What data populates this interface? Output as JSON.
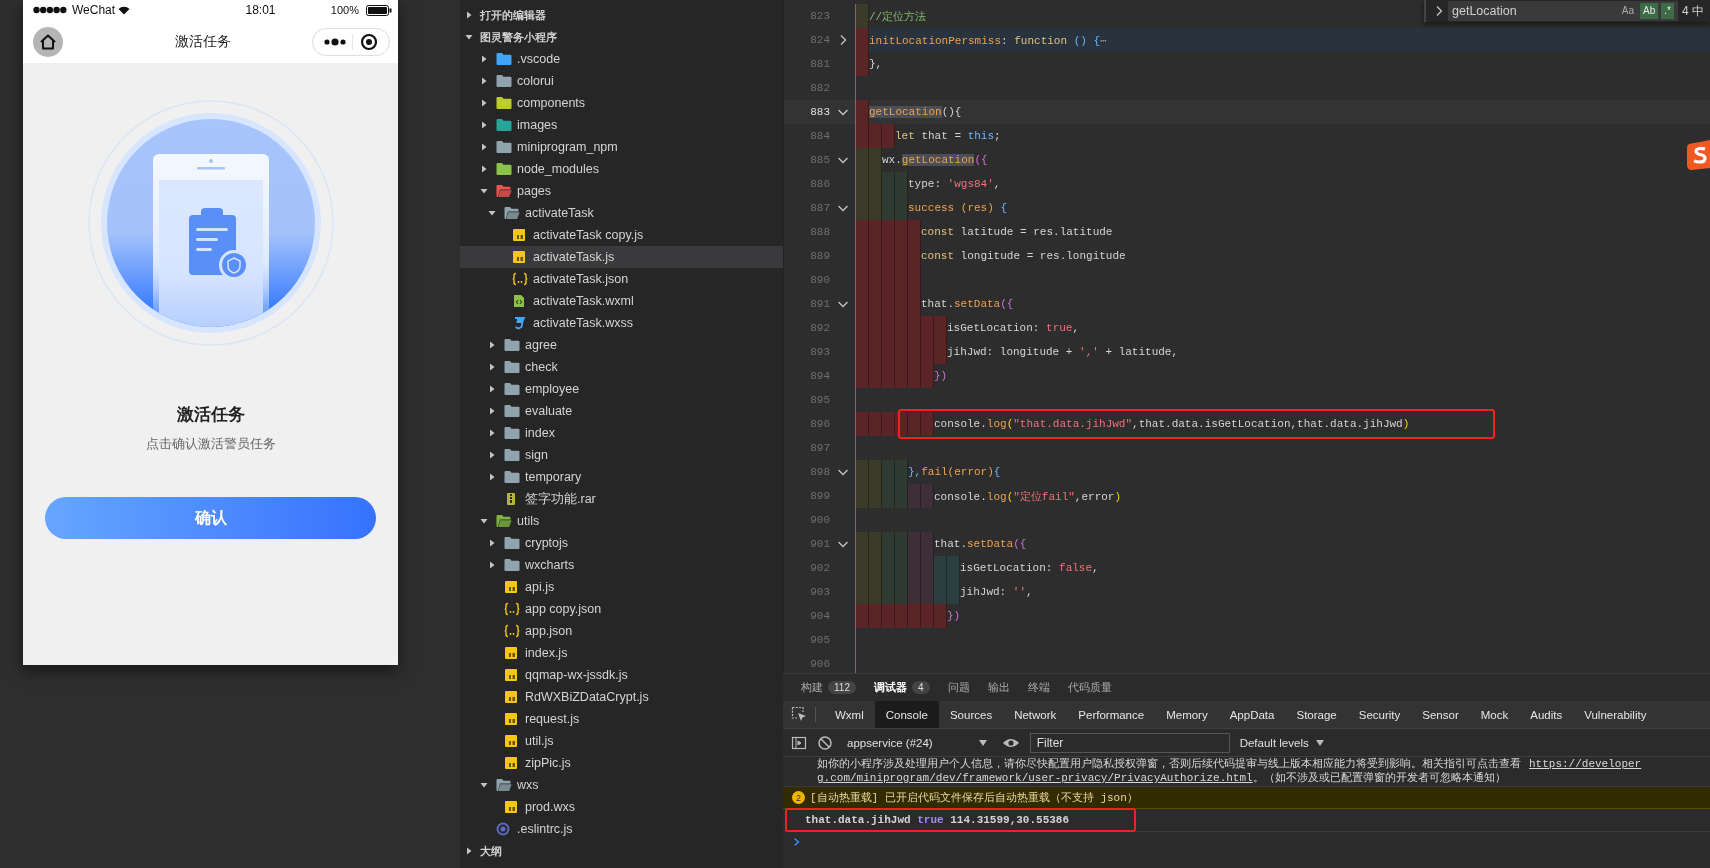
{
  "simulator": {
    "status": {
      "carrier": "WeChat",
      "time": "18:01",
      "battery": "100%"
    },
    "title": "激活任务",
    "heading": "激活任务",
    "subtitle": "点击确认激活警员任务",
    "button": "确认"
  },
  "explorer": {
    "sections": [
      {
        "label": "打开的编辑器",
        "expanded": false
      },
      {
        "label": "图灵警务小程序",
        "expanded": true,
        "items": [
          {
            "name": ".vscode",
            "kind": "folder-vscode",
            "expanded": false,
            "selected": false
          },
          {
            "name": "colorui",
            "kind": "folder",
            "expanded": false,
            "selected": false
          },
          {
            "name": "components",
            "kind": "folder-components",
            "expanded": false,
            "selected": false
          },
          {
            "name": "images",
            "kind": "folder-images",
            "expanded": false,
            "selected": false
          },
          {
            "name": "miniprogram_npm",
            "kind": "folder",
            "expanded": false,
            "selected": false
          },
          {
            "name": "node_modules",
            "kind": "folder-node",
            "expanded": false,
            "selected": false
          },
          {
            "name": "pages",
            "kind": "folder-pages",
            "expanded": true,
            "selected": false,
            "children": [
              {
                "name": "activateTask",
                "kind": "folder",
                "expanded": true,
                "selected": false,
                "children": [
                  {
                    "name": "activateTask copy.js",
                    "kind": "js",
                    "selected": false
                  },
                  {
                    "name": "activateTask.js",
                    "kind": "js",
                    "selected": true
                  },
                  {
                    "name": "activateTask.json",
                    "kind": "json",
                    "selected": false
                  },
                  {
                    "name": "activateTask.wxml",
                    "kind": "wxml",
                    "selected": false
                  },
                  {
                    "name": "activateTask.wxss",
                    "kind": "wxss",
                    "selected": false
                  }
                ]
              },
              {
                "name": "agree",
                "kind": "folder",
                "expanded": false,
                "selected": false
              },
              {
                "name": "check",
                "kind": "folder",
                "expanded": false,
                "selected": false
              },
              {
                "name": "employee",
                "kind": "folder",
                "expanded": false,
                "selected": false
              },
              {
                "name": "evaluate",
                "kind": "folder",
                "expanded": false,
                "selected": false
              },
              {
                "name": "index",
                "kind": "folder",
                "expanded": false,
                "selected": false
              },
              {
                "name": "sign",
                "kind": "folder",
                "expanded": false,
                "selected": false
              },
              {
                "name": "temporary",
                "kind": "folder",
                "expanded": false,
                "selected": false
              },
              {
                "name": "签字功能.rar",
                "kind": "rar",
                "selected": false
              }
            ]
          },
          {
            "name": "utils",
            "kind": "folder-utils",
            "expanded": true,
            "selected": false,
            "children": [
              {
                "name": "cryptojs",
                "kind": "folder",
                "expanded": false,
                "selected": false
              },
              {
                "name": "wxcharts",
                "kind": "folder",
                "expanded": false,
                "selected": false
              },
              {
                "name": "api.js",
                "kind": "js",
                "selected": false
              },
              {
                "name": "app copy.json",
                "kind": "json",
                "selected": false
              },
              {
                "name": "app.json",
                "kind": "json",
                "selected": false
              },
              {
                "name": "index.js",
                "kind": "js",
                "selected": false
              },
              {
                "name": "qqmap-wx-jssdk.js",
                "kind": "js",
                "selected": false
              },
              {
                "name": "RdWXBiZDataCrypt.js",
                "kind": "js",
                "selected": false
              },
              {
                "name": "request.js",
                "kind": "js",
                "selected": false
              },
              {
                "name": "util.js",
                "kind": "js",
                "selected": false
              },
              {
                "name": "zipPic.js",
                "kind": "js",
                "selected": false
              }
            ]
          },
          {
            "name": "wxs",
            "kind": "folder",
            "expanded": true,
            "selected": false,
            "children": [
              {
                "name": "prod.wxs",
                "kind": "js",
                "selected": false
              }
            ]
          },
          {
            "name": ".eslintrc.js",
            "kind": "eslint",
            "selected": false
          }
        ]
      },
      {
        "label": "大纲",
        "expanded": false
      }
    ]
  },
  "find": {
    "query": "getLocation",
    "toggles": [
      {
        "label": "Aa",
        "selected": false
      },
      {
        "label": "Ab",
        "selected": true
      },
      {
        "label": ".*",
        "selected": true
      }
    ],
    "result": "4 中"
  },
  "editor": {
    "lines": [
      {
        "n": "823",
        "current": false,
        "guides": [
          {
            "color": "#3b3b2a"
          }
        ],
        "tokens": [
          {
            "text": "//定位方法",
            "kind": "comment"
          }
        ]
      },
      {
        "n": "824",
        "current": false,
        "folded": true,
        "guides": [
          {
            "color": "#5b2527"
          }
        ],
        "tokens": [
          {
            "text": "initLocationPersmiss",
            "kind": "fn"
          },
          {
            "text": ": ",
            "kind": "plain"
          },
          {
            "text": "function",
            "kind": "kw"
          },
          {
            "text": " () {",
            "kind": "const"
          },
          {
            "text": "⋯",
            "kind": "dim"
          }
        ]
      },
      {
        "n": "881",
        "current": false,
        "guides": [
          {
            "color": "#5b2527"
          }
        ],
        "tokens": [
          {
            "text": "},",
            "kind": "plain"
          }
        ]
      },
      {
        "n": "882",
        "current": false
      },
      {
        "n": "883",
        "current": true,
        "folded": false,
        "guides": [
          {
            "color": "#5b2527"
          }
        ],
        "tokens": [
          {
            "text": "getLocation",
            "kind": "fn",
            "match": true
          },
          {
            "text": "(){",
            "kind": "plain"
          }
        ]
      },
      {
        "n": "884",
        "current": false,
        "guides": [
          {
            "color": "#5b2527"
          },
          {
            "color": "#5b2527"
          },
          {
            "color": "#5b2527"
          }
        ],
        "tokens": [
          {
            "text": "let",
            "kind": "kw"
          },
          {
            "text": " that = ",
            "kind": "plain"
          },
          {
            "text": "this",
            "kind": "const"
          },
          {
            "text": ";",
            "kind": "plain"
          }
        ]
      },
      {
        "n": "885",
        "current": false,
        "folded": false,
        "guides": [
          {
            "color": "#3b3b2a"
          },
          {
            "color": "#3b3b2a"
          }
        ],
        "tokens": [
          {
            "text": "wx.",
            "kind": "plain"
          },
          {
            "text": "getLocation",
            "kind": "fn",
            "match": true
          },
          {
            "text": "({",
            "kind": "br2"
          }
        ]
      },
      {
        "n": "886",
        "current": false,
        "guides": [
          {
            "color": "#3b3b2a"
          },
          {
            "color": "#3b3b2a"
          },
          {
            "color": "#2f3a32"
          },
          {
            "color": "#2f3a32"
          }
        ],
        "tokens": [
          {
            "text": "type: ",
            "kind": "plain"
          },
          {
            "text": "'wgs84'",
            "kind": "str"
          },
          {
            "text": ",",
            "kind": "plain"
          }
        ]
      },
      {
        "n": "887",
        "current": false,
        "folded": false,
        "guides": [
          {
            "color": "#3b3b2a"
          },
          {
            "color": "#3b3b2a"
          },
          {
            "color": "#2f3a32"
          },
          {
            "color": "#2f3a32"
          }
        ],
        "tokens": [
          {
            "text": "success",
            "kind": "fn"
          },
          {
            "text": " (res) ",
            "kind": "fn"
          },
          {
            "text": "{",
            "kind": "const"
          }
        ]
      },
      {
        "n": "888",
        "current": false,
        "guides": [
          {
            "color": "#5b2527"
          },
          {
            "color": "#5b2527"
          },
          {
            "color": "#5b2527"
          },
          {
            "color": "#5b2527"
          },
          {
            "color": "#5b2527"
          }
        ],
        "tokens": [
          {
            "text": "const",
            "kind": "kw"
          },
          {
            "text": " latitude = res.latitude",
            "kind": "plain"
          }
        ]
      },
      {
        "n": "889",
        "current": false,
        "guides": [
          {
            "color": "#5b2527"
          },
          {
            "color": "#5b2527"
          },
          {
            "color": "#5b2527"
          },
          {
            "color": "#5b2527"
          },
          {
            "color": "#5b2527"
          }
        ],
        "tokens": [
          {
            "text": "const",
            "kind": "kw"
          },
          {
            "text": " longitude = res.longitude",
            "kind": "plain"
          }
        ]
      },
      {
        "n": "890",
        "current": false,
        "guides": [
          {
            "color": "#5b2527"
          },
          {
            "color": "#5b2527"
          },
          {
            "color": "#5b2527"
          },
          {
            "color": "#5b2527"
          },
          {
            "color": "#5b2527"
          }
        ]
      },
      {
        "n": "891",
        "current": false,
        "folded": false,
        "guides": [
          {
            "color": "#5b2527"
          },
          {
            "color": "#5b2527"
          },
          {
            "color": "#5b2527"
          },
          {
            "color": "#5b2527"
          },
          {
            "color": "#5b2527"
          }
        ],
        "tokens": [
          {
            "text": "that.",
            "kind": "plain"
          },
          {
            "text": "setData",
            "kind": "fn"
          },
          {
            "text": "({",
            "kind": "br2"
          }
        ]
      },
      {
        "n": "892",
        "current": false,
        "guides": [
          {
            "color": "#5b2527"
          },
          {
            "color": "#5b2527"
          },
          {
            "color": "#5b2527"
          },
          {
            "color": "#5b2527"
          },
          {
            "color": "#5b2527"
          },
          {
            "color": "#5b2527"
          },
          {
            "color": "#5b2527"
          }
        ],
        "tokens": [
          {
            "text": "isGetLocation: ",
            "kind": "plain"
          },
          {
            "text": "true",
            "kind": "str"
          },
          {
            "text": ",",
            "kind": "plain"
          }
        ]
      },
      {
        "n": "893",
        "current": false,
        "guides": [
          {
            "color": "#5b2527"
          },
          {
            "color": "#5b2527"
          },
          {
            "color": "#5b2527"
          },
          {
            "color": "#5b2527"
          },
          {
            "color": "#5b2527"
          },
          {
            "color": "#5b2527"
          },
          {
            "color": "#5b2527"
          }
        ],
        "tokens": [
          {
            "text": "jihJwd: longitude + ",
            "kind": "plain"
          },
          {
            "text": "','",
            "kind": "str"
          },
          {
            "text": " + latitude,",
            "kind": "plain"
          }
        ]
      },
      {
        "n": "894",
        "current": false,
        "guides": [
          {
            "color": "#5b2527"
          },
          {
            "color": "#5b2527"
          },
          {
            "color": "#5b2527"
          },
          {
            "color": "#5b2527"
          },
          {
            "color": "#5b2527"
          },
          {
            "color": "#5b2527"
          }
        ],
        "tokens": [
          {
            "text": "})",
            "kind": "br2"
          }
        ]
      },
      {
        "n": "895",
        "current": false
      },
      {
        "n": "896",
        "current": false,
        "boxed": true,
        "guides": [
          {
            "color": "#5b2527"
          },
          {
            "color": "#5b2527"
          },
          {
            "color": "#5b2527"
          },
          {
            "color": "#5b2527"
          },
          {
            "color": "#5b2527"
          },
          {
            "color": "#5b2527"
          }
        ],
        "tokens": [
          {
            "text": "console.",
            "kind": "plain"
          },
          {
            "text": "log",
            "kind": "fn"
          },
          {
            "text": "(",
            "kind": "br1"
          },
          {
            "text": "\"that.data.jihJwd\"",
            "kind": "str"
          },
          {
            "text": ",that.data.isGetLocation,that.data.jihJwd",
            "kind": "plain"
          },
          {
            "text": ")",
            "kind": "br1"
          }
        ]
      },
      {
        "n": "897",
        "current": false
      },
      {
        "n": "898",
        "current": false,
        "folded": false,
        "guides": [
          {
            "color": "#3b3b2a"
          },
          {
            "color": "#3b3b2a"
          },
          {
            "color": "#2f3a32"
          },
          {
            "color": "#2f3a32"
          }
        ],
        "tokens": [
          {
            "text": "},",
            "kind": "const"
          },
          {
            "text": "fail",
            "kind": "fn"
          },
          {
            "text": "(error)",
            "kind": "fn"
          },
          {
            "text": "{",
            "kind": "const"
          }
        ]
      },
      {
        "n": "899",
        "current": false,
        "guides": [
          {
            "color": "#3b3b2a"
          },
          {
            "color": "#3b3b2a"
          },
          {
            "color": "#2f3a32"
          },
          {
            "color": "#2f3a32"
          },
          {
            "color": "#3d2e37"
          },
          {
            "color": "#3d2e37"
          }
        ],
        "tokens": [
          {
            "text": "console.",
            "kind": "plain"
          },
          {
            "text": "log",
            "kind": "fn"
          },
          {
            "text": "(",
            "kind": "br1"
          },
          {
            "text": "\"定位fail\"",
            "kind": "str"
          },
          {
            "text": ",error",
            "kind": "plain"
          },
          {
            "text": ")",
            "kind": "br1"
          }
        ]
      },
      {
        "n": "900",
        "current": false
      },
      {
        "n": "901",
        "current": false,
        "folded": false,
        "guides": [
          {
            "color": "#3b3b2a"
          },
          {
            "color": "#3b3b2a"
          },
          {
            "color": "#2f3a32"
          },
          {
            "color": "#2f3a32"
          },
          {
            "color": "#3d2e37"
          },
          {
            "color": "#3d2e37"
          }
        ],
        "tokens": [
          {
            "text": "that.",
            "kind": "plain"
          },
          {
            "text": "setData",
            "kind": "fn"
          },
          {
            "text": "({",
            "kind": "br2"
          }
        ]
      },
      {
        "n": "902",
        "current": false,
        "guides": [
          {
            "color": "#3b3b2a"
          },
          {
            "color": "#3b3b2a"
          },
          {
            "color": "#2f3a32"
          },
          {
            "color": "#2f3a32"
          },
          {
            "color": "#3d2e37"
          },
          {
            "color": "#3d2e37"
          },
          {
            "color": "#2c3f3f"
          },
          {
            "color": "#2c3f3f"
          }
        ],
        "tokens": [
          {
            "text": "isGetLocation: ",
            "kind": "plain"
          },
          {
            "text": "false",
            "kind": "str"
          },
          {
            "text": ",",
            "kind": "plain"
          }
        ]
      },
      {
        "n": "903",
        "current": false,
        "guides": [
          {
            "color": "#3b3b2a"
          },
          {
            "color": "#3b3b2a"
          },
          {
            "color": "#2f3a32"
          },
          {
            "color": "#2f3a32"
          },
          {
            "color": "#3d2e37"
          },
          {
            "color": "#3d2e37"
          },
          {
            "color": "#2c3f3f"
          },
          {
            "color": "#2c3f3f"
          }
        ],
        "tokens": [
          {
            "text": "jihJwd: ",
            "kind": "plain"
          },
          {
            "text": "''",
            "kind": "str"
          },
          {
            "text": ",",
            "kind": "plain"
          }
        ]
      },
      {
        "n": "904",
        "current": false,
        "guides": [
          {
            "color": "#5b2527"
          },
          {
            "color": "#5b2527"
          },
          {
            "color": "#5b2527"
          },
          {
            "color": "#5b2527"
          },
          {
            "color": "#5b2527"
          },
          {
            "color": "#5b2527"
          },
          {
            "color": "#5b2527"
          }
        ],
        "tokens": [
          {
            "text": "})",
            "kind": "br2"
          }
        ]
      },
      {
        "n": "905",
        "current": false
      },
      {
        "n": "906",
        "current": false
      }
    ]
  },
  "panel": {
    "tabs": [
      {
        "label": "构建",
        "badge": "112",
        "selected": false
      },
      {
        "label": "调试器",
        "badge": "4",
        "selected": true
      },
      {
        "label": "问题",
        "selected": false
      },
      {
        "label": "输出",
        "selected": false
      },
      {
        "label": "终端",
        "selected": false
      },
      {
        "label": "代码质量",
        "selected": false
      }
    ],
    "devtools_tabs": [
      {
        "label": "Wxml",
        "selected": false
      },
      {
        "label": "Console",
        "selected": true
      },
      {
        "label": "Sources",
        "selected": false
      },
      {
        "label": "Network",
        "selected": false
      },
      {
        "label": "Performance",
        "selected": false
      },
      {
        "label": "Memory",
        "selected": false
      },
      {
        "label": "AppData",
        "selected": false
      },
      {
        "label": "Storage",
        "selected": false
      },
      {
        "label": "Security",
        "selected": false
      },
      {
        "label": "Sensor",
        "selected": false
      },
      {
        "label": "Mock",
        "selected": false
      },
      {
        "label": "Audits",
        "selected": false
      },
      {
        "label": "Vulnerability",
        "selected": false
      }
    ],
    "toolbar": {
      "context": "appservice (#24)",
      "filter_placeholder": "Filter",
      "levels": "Default levels"
    },
    "console": {
      "notice": {
        "text": "如你的小程序涉及处理用户个人信息，请你尽快配置用户隐私授权弹窗，否则后续代码提审与线上版本相应能力将受到影响。相关指引可点击查看",
        "link": "https://developer",
        "link_cont": "g.com/miniprogram/dev/framework/user-privacy/PrivacyAuthorize.html",
        "tail": "。（如不涉及或已配置弹窗的开发者可忽略本通知）"
      },
      "warning": {
        "count": "2",
        "text": "[自动热重载] 已开启代码文件保存后自动热重载（不支持 json）"
      },
      "log": {
        "boxed": true,
        "parts": [
          {
            "text": "that.data.jihJwd",
            "kind": "plain"
          },
          {
            "text": "true",
            "kind": "bool"
          },
          {
            "text": "114.31599,30.55386",
            "kind": "plain"
          }
        ]
      }
    }
  }
}
